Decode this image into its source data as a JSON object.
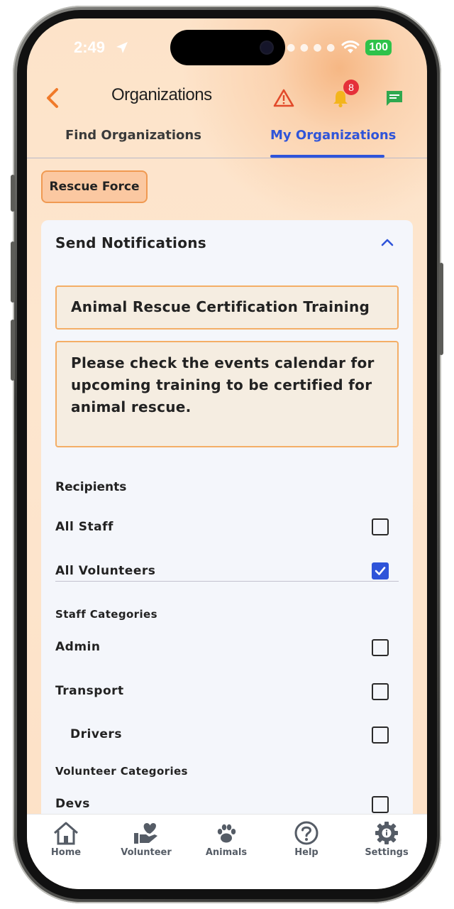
{
  "status_bar": {
    "time": "2:49",
    "battery": "100"
  },
  "header": {
    "title": "Organizations",
    "notification_count": "8"
  },
  "tabs": [
    {
      "label": "Find Organizations",
      "active": false
    },
    {
      "label": "My Organizations",
      "active": true
    }
  ],
  "org_chip": "Rescue Force",
  "notify": {
    "section_title": "Send Notifications",
    "title_value": "Animal Rescue Certification Training",
    "message_value": "Please check the events calendar for upcoming training to be certified for animal rescue.",
    "recipients_label": "Recipients",
    "recipients": [
      {
        "label": "All Staff",
        "checked": false
      },
      {
        "label": "All Volunteers",
        "checked": true
      }
    ],
    "staff_categories_label": "Staff Categories",
    "staff_categories": [
      {
        "label": "Admin",
        "checked": false
      },
      {
        "label": "Transport",
        "checked": false
      },
      {
        "label": "Drivers",
        "checked": false
      }
    ],
    "volunteer_categories_label": "Volunteer Categories",
    "volunteer_categories": [
      {
        "label": "Devs",
        "checked": false
      }
    ]
  },
  "bottom_nav": [
    {
      "label": "Home",
      "icon": "home-icon"
    },
    {
      "label": "Volunteer",
      "icon": "volunteer-icon"
    },
    {
      "label": "Animals",
      "icon": "paw-icon"
    },
    {
      "label": "Help",
      "icon": "help-icon"
    },
    {
      "label": "Settings",
      "icon": "settings-icon"
    }
  ],
  "colors": {
    "accent": "#2f54d9",
    "orange": "#f07a2a",
    "chip_bg": "#fbc8a1",
    "field_border": "#f4ae66"
  }
}
